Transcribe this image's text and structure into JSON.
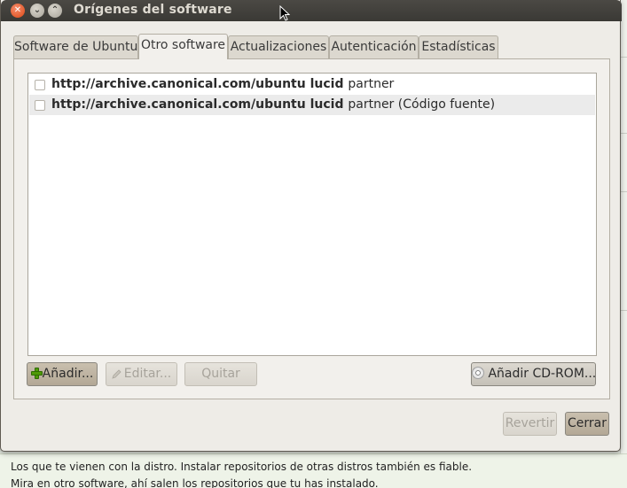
{
  "window": {
    "title": "Orígenes del software",
    "close_glyph": "✕",
    "min_glyph": "⌄",
    "max_glyph": "⌃"
  },
  "tabs": [
    {
      "label": "Software de Ubuntu",
      "active": false
    },
    {
      "label": "Otro software",
      "active": true
    },
    {
      "label": "Actualizaciones",
      "active": false
    },
    {
      "label": "Autenticación",
      "active": false
    },
    {
      "label": "Estadísticas",
      "active": false
    }
  ],
  "sources": [
    {
      "url": "http://archive.canonical.com/ubuntu",
      "suite": "lucid",
      "components": "partner",
      "checked": false
    },
    {
      "url": "http://archive.canonical.com/ubuntu",
      "suite": "lucid",
      "components": "partner (Código fuente)",
      "checked": false
    }
  ],
  "buttons": {
    "add": "Añadir...",
    "edit": "Editar...",
    "remove": "Quitar",
    "add_cdrom": "Añadir CD-ROM...",
    "revert": "Revertir",
    "close": "Cerrar"
  },
  "icons": {
    "add": "plus-icon",
    "edit": "pencil-icon",
    "cdrom": "cdrom-icon"
  },
  "page_text": {
    "line1": "Los que te vienen con la distro. Instalar repositorios de otras distros también es fiable.",
    "line2": "Mira en otro software, ahí salen los repositorios que tu has instalado."
  }
}
